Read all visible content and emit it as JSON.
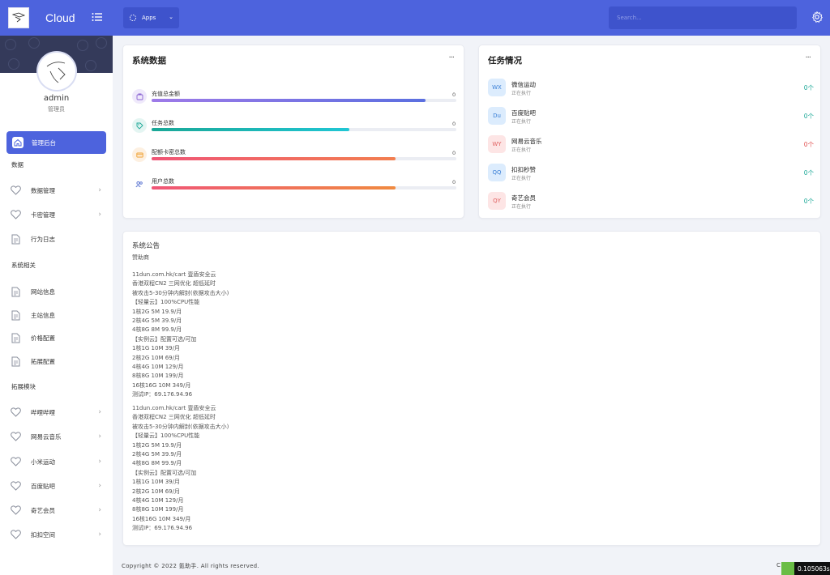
{
  "sidebar": {
    "brand": "Cloud",
    "user": {
      "name": "admin",
      "role": "管理员"
    },
    "active_item": "管理后台",
    "sections": [
      {
        "title": "数据",
        "items": [
          {
            "label": "数据管理",
            "icon": "heart-icon",
            "chevron": true
          },
          {
            "label": "卡密管理",
            "icon": "heart-icon",
            "chevron": true
          },
          {
            "label": "行为日志",
            "icon": "document-icon",
            "chevron": false
          }
        ]
      },
      {
        "title": "系统相关",
        "items": [
          {
            "label": "网站信息",
            "icon": "document-icon",
            "chevron": false
          },
          {
            "label": "主站信息",
            "icon": "document-icon",
            "chevron": false
          },
          {
            "label": "价格配置",
            "icon": "document-icon",
            "chevron": false
          },
          {
            "label": "拓展配置",
            "icon": "document-icon",
            "chevron": false
          }
        ]
      },
      {
        "title": "拓展模块",
        "items": [
          {
            "label": "哔哩哔哩",
            "icon": "heart-icon",
            "chevron": true
          },
          {
            "label": "网易云音乐",
            "icon": "heart-icon",
            "chevron": true
          },
          {
            "label": "小米运动",
            "icon": "heart-icon",
            "chevron": true
          },
          {
            "label": "百度贴吧",
            "icon": "heart-icon",
            "chevron": true
          },
          {
            "label": "奇艺会员",
            "icon": "heart-icon",
            "chevron": true
          },
          {
            "label": "扣扣空间",
            "icon": "heart-icon",
            "chevron": true
          }
        ]
      }
    ]
  },
  "topbar": {
    "apps_label": "Apps",
    "search_placeholder": "Search..."
  },
  "stats_card": {
    "title": "系统数据",
    "menu": "···",
    "rows": [
      {
        "label": "充值总金额",
        "value": "0",
        "progress": 0.9,
        "color": "#9e7ae8",
        "color2": "#5b6fe0",
        "icon_bg": "#efe9fb",
        "icon_color": "#8a63d2"
      },
      {
        "label": "任务总数",
        "value": "0",
        "progress": 0.65,
        "color": "#1aa796",
        "color2": "#20c6d4",
        "icon_bg": "#e4f5f2",
        "icon_color": "#1aa796"
      },
      {
        "label": "配额卡密总数",
        "value": "0",
        "progress": 0.8,
        "color": "#f05577",
        "color2": "#f27e4f",
        "icon_bg": "#fdf0e1",
        "icon_color": "#f0a030"
      },
      {
        "label": "用户总数",
        "value": "0",
        "progress": 0.8,
        "color": "#f05577",
        "color2": "#f08a40",
        "icon_bg": "#ffffff",
        "icon_color": "#5570d0"
      }
    ]
  },
  "tasks_card": {
    "title": "任务情况",
    "menu": "···",
    "rows": [
      {
        "badge": "WX",
        "name": "微信运动",
        "status": "正在执行",
        "count": "0个",
        "bg": "#dcecfd",
        "fg": "#3a7fd6",
        "count_color": "#1aa796"
      },
      {
        "badge": "Du",
        "name": "百度贴吧",
        "status": "正在执行",
        "count": "0个",
        "bg": "#dcecfd",
        "fg": "#3a7fd6",
        "count_color": "#1aa796"
      },
      {
        "badge": "WY",
        "name": "网易云音乐",
        "status": "正在执行",
        "count": "0个",
        "bg": "#fde5e5",
        "fg": "#e06060",
        "count_color": "#e05050"
      },
      {
        "badge": "QQ",
        "name": "扣扣秒赞",
        "status": "正在执行",
        "count": "0个",
        "bg": "#dcecfd",
        "fg": "#3a7fd6",
        "count_color": "#1aa796"
      },
      {
        "badge": "QY",
        "name": "奇艺会员",
        "status": "正在执行",
        "count": "0个",
        "bg": "#fde5e5",
        "fg": "#e06060",
        "count_color": "#1aa796"
      }
    ]
  },
  "notice_card": {
    "title": "系统公告",
    "subtitle": "赞助商",
    "blocks": [
      [
        "11dun.com.hk/cart 壹盾安全云",
        "香港双程CN2 三网优化 超低延时",
        "被攻击5-30分钟内解封(依据攻击大小)",
        "【轻量云】100%CPU性能",
        "1核2G 5M 19.9/月",
        "2核4G 5M 39.9/月",
        "4核8G 8M 99.9/月",
        "【实例云】配置可选/可加",
        "1核1G 10M 39/月",
        "2核2G 10M 69/月",
        "4核4G 10M 129/月",
        "8核8G 10M 199/月",
        "16核16G 10M 349/月",
        "测试IP：69.176.94.96"
      ],
      [
        "11dun.com.hk/cart 壹盾安全云",
        "香港双程CN2 三网优化 超低延时",
        "被攻击5-30分钟内解封(依据攻击大小)",
        "【轻量云】100%CPU性能",
        "1核2G 5M 19.9/月",
        "2核4G 5M 39.9/月",
        "4核8G 8M 99.9/月",
        "【实例云】配置可选/可加",
        "1核1G 10M 39/月",
        "2核2G 10M 69/月",
        "4核4G 10M 129/月",
        "8核8G 10M 199/月",
        "16核16G 10M 349/月",
        "测试IP：69.176.94.96"
      ]
    ]
  },
  "footer": {
    "copyright": "Copyright © 2022 氪助手. All rights reserved.",
    "right_letter": "C",
    "timer": "0.105063s"
  }
}
